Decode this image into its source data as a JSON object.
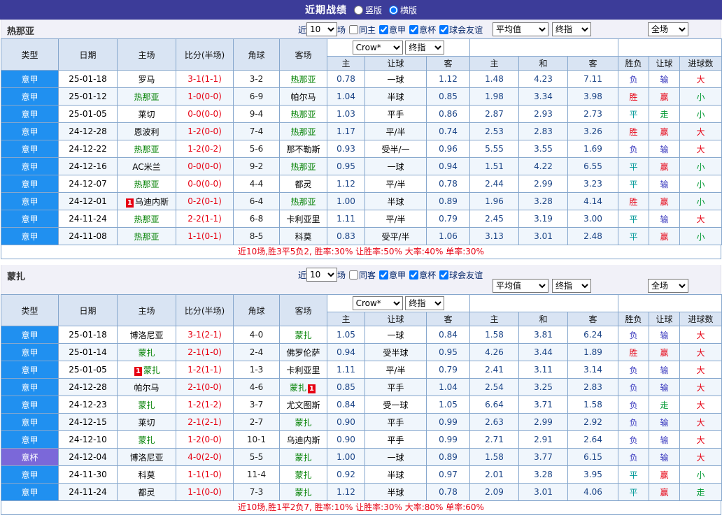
{
  "top_bar": {
    "title": "近期战绩",
    "radios": [
      {
        "label": "竖版",
        "selected": false
      },
      {
        "label": "横版",
        "selected": true
      }
    ]
  },
  "labels": {
    "near": "近",
    "games": "场",
    "col_type": "类型",
    "col_date": "日期",
    "col_home": "主场",
    "col_score": "比分(半场)",
    "col_corner": "角球",
    "col_away": "客场",
    "bookmaker": "Crow*",
    "final": "终指",
    "avg": "平均值",
    "full": "全场",
    "sub_home": "主",
    "sub_hc": "让球",
    "sub_away": "客",
    "sub_draw": "和",
    "sub_result": "胜负",
    "sub_goals": "进球数"
  },
  "colors": {
    "topbar_bg": "#3c3c99",
    "league_bg": "#2090f0",
    "cup_bg": "#7b68d9",
    "focus_team": "#008000",
    "score_red": "#e60012",
    "win_red": "#e60012",
    "draw_teal": "#009898",
    "lose_blue": "#3b3bbf",
    "small_green": "#009933"
  },
  "sections": [
    {
      "team": "热那亚",
      "count": "10",
      "filters": [
        {
          "label": "同主",
          "checked": false
        },
        {
          "label": "意甲",
          "checked": true
        },
        {
          "label": "意杯",
          "checked": true
        },
        {
          "label": "球会友谊",
          "checked": true
        }
      ],
      "summary": "近10场,胜3平5负2, 胜率:30% 让胜率:50% 大率:40% 单率:30%",
      "rows": [
        {
          "type": "意甲",
          "date": "25-01-18",
          "home": "罗马",
          "away": "热那亚",
          "af": true,
          "score": "3-1(1-1)",
          "corner": "3-2",
          "o1": "0.78",
          "hc": "一球",
          "o2": "1.12",
          "a1": "1.48",
          "a2": "4.23",
          "a3": "7.11",
          "res": "负",
          "res_c": "l",
          "hres": "输",
          "hres_c": "l",
          "goal": "大",
          "goal_c": "r"
        },
        {
          "type": "意甲",
          "date": "25-01-12",
          "home": "热那亚",
          "hf": true,
          "away": "帕尔马",
          "score": "1-0(0-0)",
          "corner": "6-9",
          "o1": "1.04",
          "hc": "半球",
          "o2": "0.85",
          "a1": "1.98",
          "a2": "3.34",
          "a3": "3.98",
          "res": "胜",
          "res_c": "w",
          "hres": "赢",
          "hres_c": "w",
          "goal": "小",
          "goal_c": "g"
        },
        {
          "type": "意甲",
          "date": "25-01-05",
          "home": "莱切",
          "away": "热那亚",
          "af": true,
          "score": "0-0(0-0)",
          "corner": "9-4",
          "o1": "1.03",
          "hc": "平手",
          "o2": "0.86",
          "a1": "2.87",
          "a2": "2.93",
          "a3": "2.73",
          "res": "平",
          "res_c": "d",
          "hres": "走",
          "hres_c": "g",
          "goal": "小",
          "goal_c": "g"
        },
        {
          "type": "意甲",
          "date": "24-12-28",
          "home": "恩波利",
          "away": "热那亚",
          "af": true,
          "score": "1-2(0-0)",
          "corner": "7-4",
          "o1": "1.17",
          "hc": "平/半",
          "o2": "0.74",
          "a1": "2.53",
          "a2": "2.83",
          "a3": "3.26",
          "res": "胜",
          "res_c": "w",
          "hres": "赢",
          "hres_c": "w",
          "goal": "大",
          "goal_c": "r"
        },
        {
          "type": "意甲",
          "date": "24-12-22",
          "home": "热那亚",
          "hf": true,
          "away": "那不勒斯",
          "score": "1-2(0-2)",
          "corner": "5-6",
          "o1": "0.93",
          "hc": "受半/一",
          "o2": "0.96",
          "a1": "5.55",
          "a2": "3.55",
          "a3": "1.69",
          "res": "负",
          "res_c": "l",
          "hres": "输",
          "hres_c": "l",
          "goal": "大",
          "goal_c": "r"
        },
        {
          "type": "意甲",
          "date": "24-12-16",
          "home": "AC米兰",
          "away": "热那亚",
          "af": true,
          "score": "0-0(0-0)",
          "corner": "9-2",
          "o1": "0.95",
          "hc": "一球",
          "o2": "0.94",
          "a1": "1.51",
          "a2": "4.22",
          "a3": "6.55",
          "res": "平",
          "res_c": "d",
          "hres": "赢",
          "hres_c": "w",
          "goal": "小",
          "goal_c": "g"
        },
        {
          "type": "意甲",
          "date": "24-12-07",
          "home": "热那亚",
          "hf": true,
          "away": "都灵",
          "score": "0-0(0-0)",
          "corner": "4-4",
          "o1": "1.12",
          "hc": "平/半",
          "o2": "0.78",
          "a1": "2.44",
          "a2": "2.99",
          "a3": "3.23",
          "res": "平",
          "res_c": "d",
          "hres": "输",
          "hres_c": "l",
          "goal": "小",
          "goal_c": "g"
        },
        {
          "type": "意甲",
          "date": "24-12-01",
          "home": "乌迪内斯",
          "hbadge": "1",
          "away": "热那亚",
          "af": true,
          "score": "0-2(0-1)",
          "corner": "6-4",
          "o1": "1.00",
          "hc": "半球",
          "o2": "0.89",
          "a1": "1.96",
          "a2": "3.28",
          "a3": "4.14",
          "res": "胜",
          "res_c": "w",
          "hres": "赢",
          "hres_c": "w",
          "goal": "小",
          "goal_c": "g"
        },
        {
          "type": "意甲",
          "date": "24-11-24",
          "home": "热那亚",
          "hf": true,
          "away": "卡利亚里",
          "score": "2-2(1-1)",
          "corner": "6-8",
          "o1": "1.11",
          "hc": "平/半",
          "o2": "0.79",
          "a1": "2.45",
          "a2": "3.19",
          "a3": "3.00",
          "res": "平",
          "res_c": "d",
          "hres": "输",
          "hres_c": "l",
          "goal": "大",
          "goal_c": "r"
        },
        {
          "type": "意甲",
          "date": "24-11-08",
          "home": "热那亚",
          "hf": true,
          "away": "科莫",
          "score": "1-1(0-1)",
          "corner": "8-5",
          "o1": "0.83",
          "hc": "受平/半",
          "o2": "1.06",
          "a1": "3.13",
          "a2": "3.01",
          "a3": "2.48",
          "res": "平",
          "res_c": "d",
          "hres": "赢",
          "hres_c": "w",
          "goal": "小",
          "goal_c": "g"
        }
      ]
    },
    {
      "team": "蒙扎",
      "count": "10",
      "filters": [
        {
          "label": "同客",
          "checked": false
        },
        {
          "label": "意甲",
          "checked": true
        },
        {
          "label": "意杯",
          "checked": true
        },
        {
          "label": "球会友谊",
          "checked": true
        }
      ],
      "summary": "近10场,胜1平2负7, 胜率:10% 让胜率:30% 大率:80% 单率:60%",
      "rows": [
        {
          "type": "意甲",
          "date": "25-01-18",
          "home": "博洛尼亚",
          "away": "蒙扎",
          "af": true,
          "score": "3-1(2-1)",
          "corner": "4-0",
          "o1": "1.05",
          "hc": "一球",
          "o2": "0.84",
          "a1": "1.58",
          "a2": "3.81",
          "a3": "6.24",
          "res": "负",
          "res_c": "l",
          "hres": "输",
          "hres_c": "l",
          "goal": "大",
          "goal_c": "r"
        },
        {
          "type": "意甲",
          "date": "25-01-14",
          "home": "蒙扎",
          "hf": true,
          "away": "佛罗伦萨",
          "score": "2-1(1-0)",
          "corner": "2-4",
          "o1": "0.94",
          "hc": "受半球",
          "o2": "0.95",
          "a1": "4.26",
          "a2": "3.44",
          "a3": "1.89",
          "res": "胜",
          "res_c": "w",
          "hres": "赢",
          "hres_c": "w",
          "goal": "大",
          "goal_c": "r"
        },
        {
          "type": "意甲",
          "date": "25-01-05",
          "home": "蒙扎",
          "hf": true,
          "hbadge": "1",
          "away": "卡利亚里",
          "score": "1-2(1-1)",
          "corner": "1-3",
          "o1": "1.11",
          "hc": "平/半",
          "o2": "0.79",
          "a1": "2.41",
          "a2": "3.11",
          "a3": "3.14",
          "res": "负",
          "res_c": "l",
          "hres": "输",
          "hres_c": "l",
          "goal": "大",
          "goal_c": "r"
        },
        {
          "type": "意甲",
          "date": "24-12-28",
          "home": "帕尔马",
          "away": "蒙扎",
          "af": true,
          "abadge_post": "1",
          "score": "2-1(0-0)",
          "corner": "4-6",
          "o1": "0.85",
          "hc": "平手",
          "o2": "1.04",
          "a1": "2.54",
          "a2": "3.25",
          "a3": "2.83",
          "res": "负",
          "res_c": "l",
          "hres": "输",
          "hres_c": "l",
          "goal": "大",
          "goal_c": "r"
        },
        {
          "type": "意甲",
          "date": "24-12-23",
          "home": "蒙扎",
          "hf": true,
          "away": "尤文图斯",
          "score": "1-2(1-2)",
          "corner": "3-7",
          "o1": "0.84",
          "hc": "受一球",
          "o2": "1.05",
          "a1": "6.64",
          "a2": "3.71",
          "a3": "1.58",
          "res": "负",
          "res_c": "l",
          "hres": "走",
          "hres_c": "g",
          "goal": "大",
          "goal_c": "r"
        },
        {
          "type": "意甲",
          "date": "24-12-15",
          "home": "莱切",
          "away": "蒙扎",
          "af": true,
          "score": "2-1(2-1)",
          "corner": "2-7",
          "o1": "0.90",
          "hc": "平手",
          "o2": "0.99",
          "a1": "2.63",
          "a2": "2.99",
          "a3": "2.92",
          "res": "负",
          "res_c": "l",
          "hres": "输",
          "hres_c": "l",
          "goal": "大",
          "goal_c": "r"
        },
        {
          "type": "意甲",
          "date": "24-12-10",
          "home": "蒙扎",
          "hf": true,
          "away": "乌迪内斯",
          "score": "1-2(0-0)",
          "corner": "10-1",
          "o1": "0.90",
          "hc": "平手",
          "o2": "0.99",
          "a1": "2.71",
          "a2": "2.91",
          "a3": "2.64",
          "res": "负",
          "res_c": "l",
          "hres": "输",
          "hres_c": "l",
          "goal": "大",
          "goal_c": "r"
        },
        {
          "type": "意杯",
          "cup": true,
          "date": "24-12-04",
          "home": "博洛尼亚",
          "away": "蒙扎",
          "af": true,
          "score": "4-0(2-0)",
          "corner": "5-5",
          "o1": "1.00",
          "hc": "一球",
          "o2": "0.89",
          "a1": "1.58",
          "a2": "3.77",
          "a3": "6.15",
          "res": "负",
          "res_c": "l",
          "hres": "输",
          "hres_c": "l",
          "goal": "大",
          "goal_c": "r"
        },
        {
          "type": "意甲",
          "date": "24-11-30",
          "home": "科莫",
          "away": "蒙扎",
          "af": true,
          "score": "1-1(1-0)",
          "corner": "11-4",
          "o1": "0.92",
          "hc": "半球",
          "o2": "0.97",
          "a1": "2.01",
          "a2": "3.28",
          "a3": "3.95",
          "res": "平",
          "res_c": "d",
          "hres": "赢",
          "hres_c": "w",
          "goal": "小",
          "goal_c": "g"
        },
        {
          "type": "意甲",
          "date": "24-11-24",
          "home": "都灵",
          "away": "蒙扎",
          "af": true,
          "score": "1-1(0-0)",
          "corner": "7-3",
          "o1": "1.12",
          "hc": "半球",
          "o2": "0.78",
          "a1": "2.09",
          "a2": "3.01",
          "a3": "4.06",
          "res": "平",
          "res_c": "d",
          "hres": "赢",
          "hres_c": "w",
          "goal": "走",
          "goal_c": "g"
        }
      ]
    }
  ]
}
